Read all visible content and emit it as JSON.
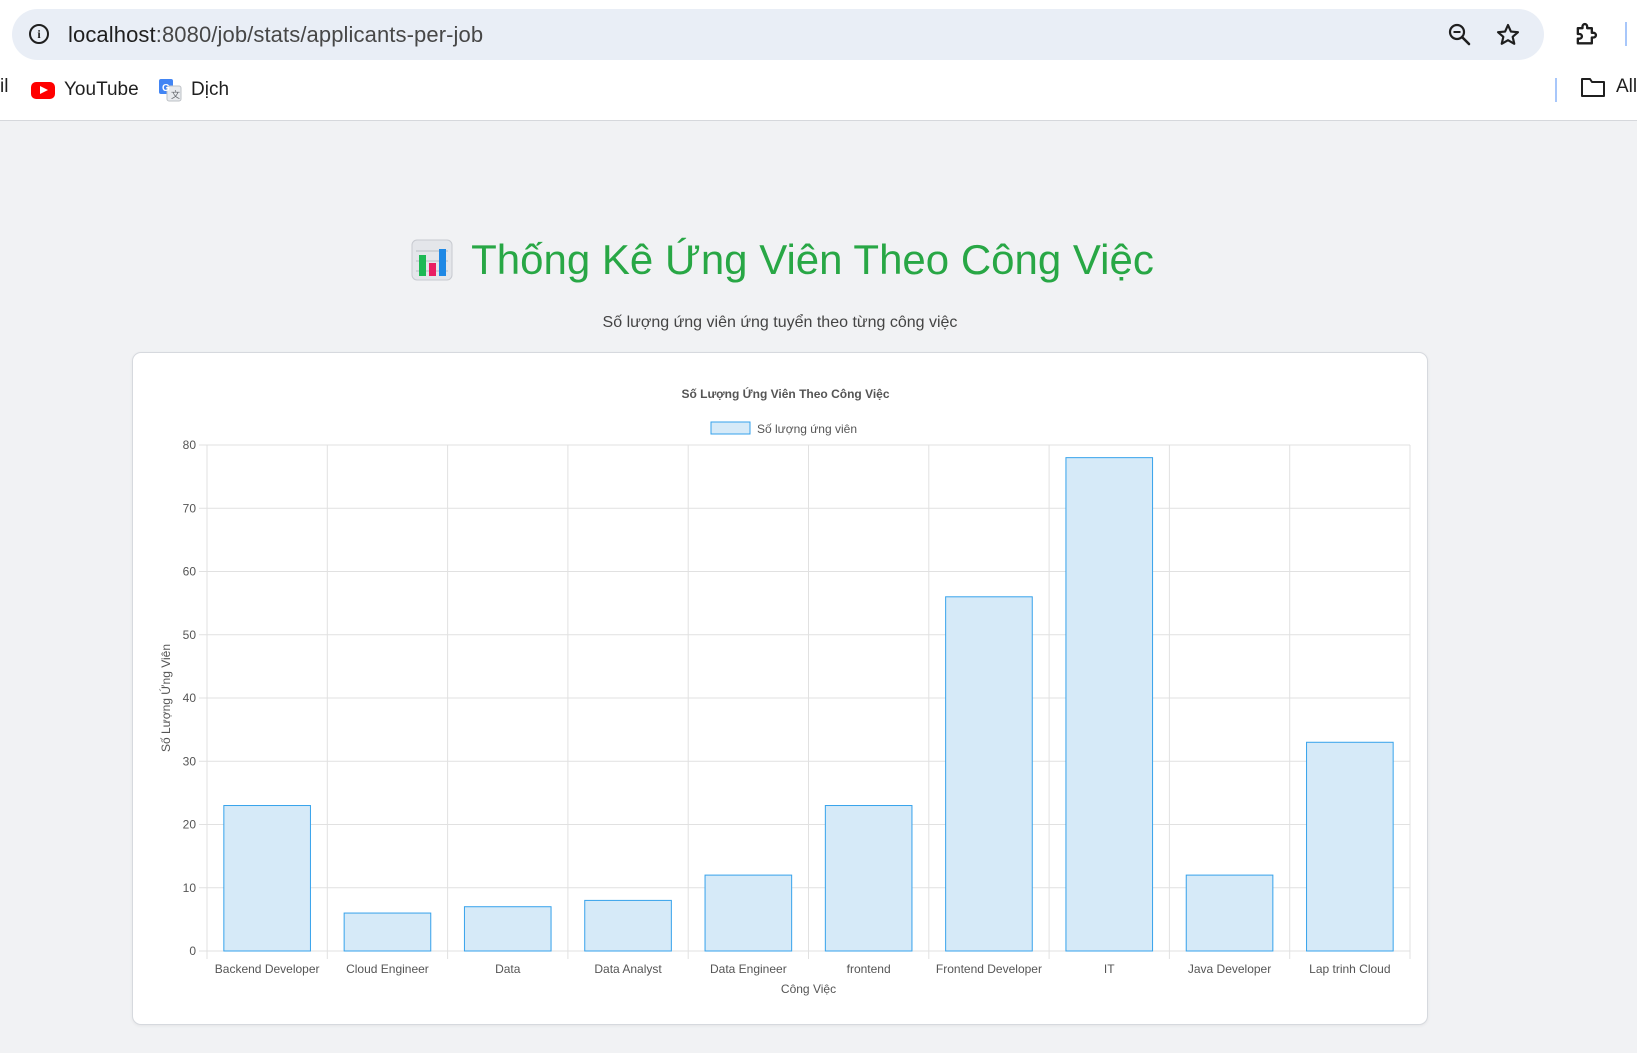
{
  "browser": {
    "url_host": "localhost",
    "url_path": ":8080/job/stats/applicants-per-job",
    "bookmarks": [
      {
        "label": "YouTube",
        "icon": "youtube-icon"
      },
      {
        "label": "Dịch",
        "icon": "google-translate-icon"
      }
    ],
    "bookmark_cut_label": "il",
    "all_bookmarks_label": "All"
  },
  "page": {
    "title": "Thống Kê Ứng Viên Theo Công Việc",
    "title_icon": "bar-chart-icon",
    "subtitle": "Số lượng ứng viên ứng tuyển theo từng công việc",
    "title_color": "#28a745"
  },
  "chart_data": {
    "type": "bar",
    "title": "Số Lượng Ứng Viên Theo Công Việc",
    "legend_position": "top",
    "xlabel": "Công Việc",
    "ylabel": "Số Lượng Ứng Viên",
    "ylim": [
      0,
      80
    ],
    "y_ticks": [
      0,
      10,
      20,
      30,
      40,
      50,
      60,
      70,
      80
    ],
    "grid": true,
    "categories": [
      "Backend Developer",
      "Cloud Engineer",
      "Data",
      "Data Analyst",
      "Data Engineer",
      "frontend",
      "Frontend Developer",
      "IT",
      "Java Developer",
      "Lap trinh Cloud"
    ],
    "series": [
      {
        "name": "Số lượng ứng viên",
        "values": [
          23,
          6,
          7,
          8,
          12,
          23,
          56,
          78,
          12,
          33
        ],
        "fill": "#d6eaf8",
        "stroke": "#36a2eb"
      }
    ]
  }
}
